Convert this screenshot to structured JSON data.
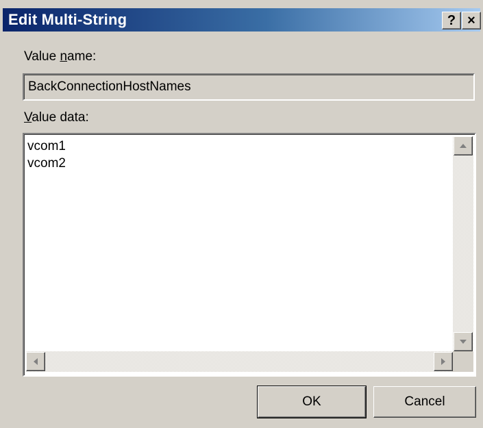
{
  "dialog": {
    "title": "Edit Multi-String",
    "help_label": "?",
    "close_label": "×"
  },
  "value_name": {
    "label_mnemonic_prefix": "Value ",
    "label_mnemonic_char": "n",
    "label_mnemonic_suffix": "ame:",
    "value": "BackConnectionHostNames"
  },
  "value_data": {
    "label_mnemonic_char": "V",
    "label_mnemonic_suffix": "alue data:",
    "lines": [
      "vcom1",
      "vcom2"
    ]
  },
  "buttons": {
    "ok": "OK",
    "cancel": "Cancel"
  },
  "colors": {
    "title_gradient_start": "#0a246a",
    "title_gradient_end": "#a6caf0",
    "face": "#d4d0c8"
  }
}
